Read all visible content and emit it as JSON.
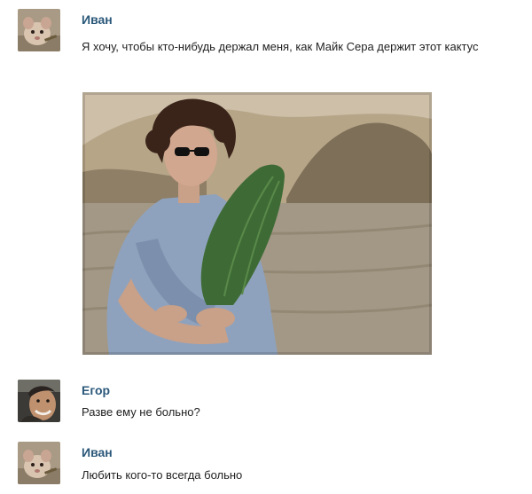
{
  "messages": [
    {
      "author": "Иван",
      "text": "Я хочу, чтобы кто-нибудь держал меня, как Майк Сера держит этот кактус",
      "attachment": "photo-man-holding-cactus"
    },
    {
      "author": "Егор",
      "text": "Разве ему не больно?"
    },
    {
      "author": "Иван",
      "text": "Любить кого-то всегда больно"
    }
  ],
  "colors": {
    "author_link": "#2b587a",
    "message_text": "#222222",
    "background": "#ffffff"
  },
  "icons": {
    "avatar_ivan": "rat-avatar-icon",
    "avatar_egor": "man-face-avatar-icon"
  }
}
